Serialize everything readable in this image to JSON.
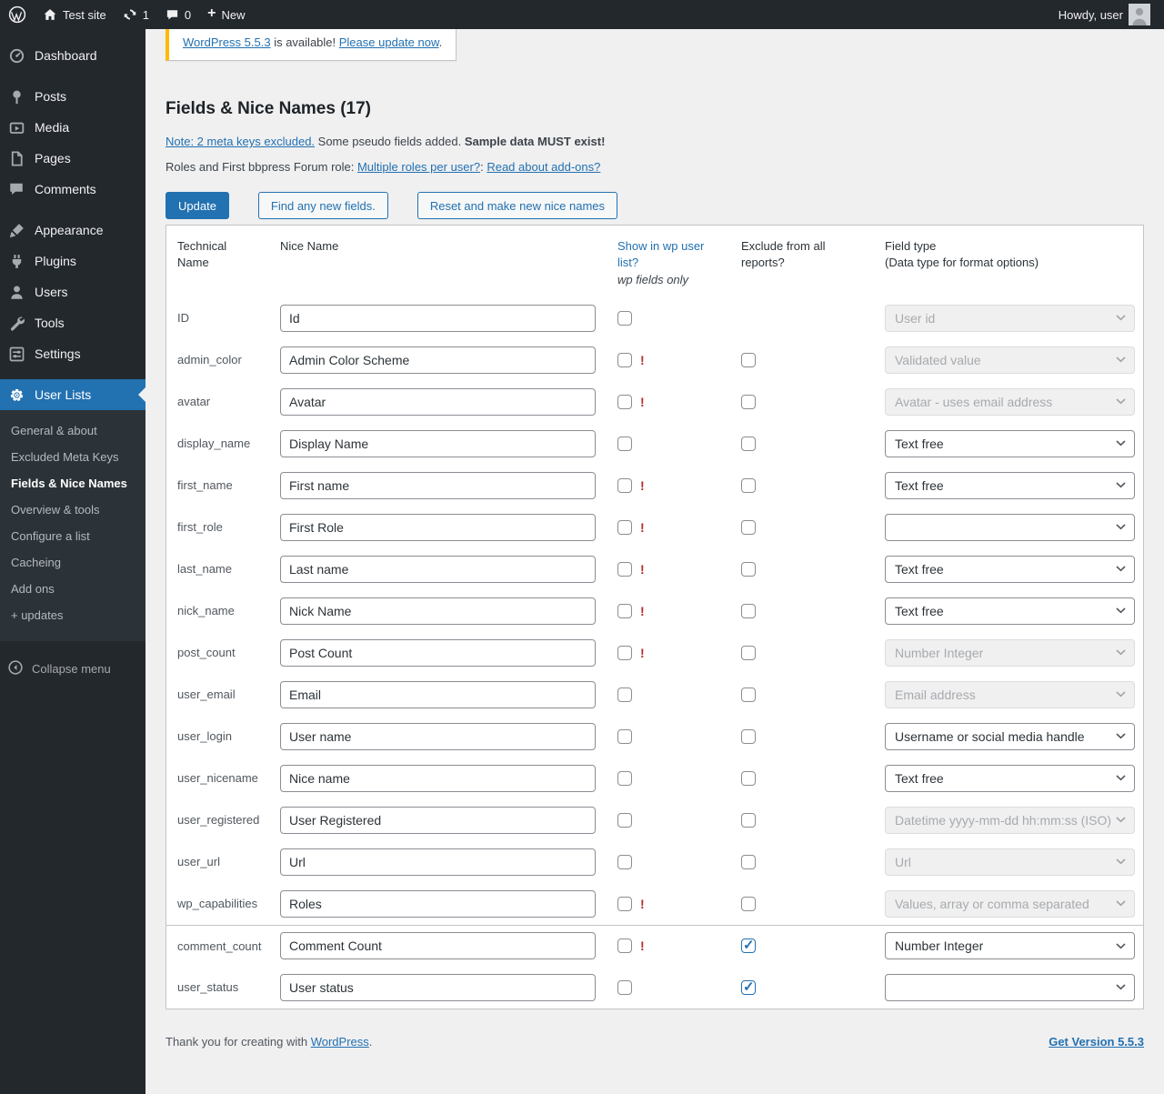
{
  "colors": {
    "accent": "#2271b1",
    "warning": "#b32d2e",
    "notice_accent": "#ffb900",
    "bar": "#23282d",
    "pagebg": "#f0f0f1"
  },
  "admin_bar": {
    "site_name": "Test site",
    "update_count": "1",
    "comment_count": "0",
    "new_label": "New",
    "howdy": "Howdy, user"
  },
  "sidebar": {
    "items": [
      {
        "label": "Dashboard",
        "icon": "dashboard-icon"
      },
      {
        "label": "Posts",
        "icon": "pin-icon"
      },
      {
        "label": "Media",
        "icon": "media-icon"
      },
      {
        "label": "Pages",
        "icon": "pages-icon"
      },
      {
        "label": "Comments",
        "icon": "comment-bubble-icon"
      },
      {
        "label": "Appearance",
        "icon": "brush-icon"
      },
      {
        "label": "Plugins",
        "icon": "plug-icon"
      },
      {
        "label": "Users",
        "icon": "person-icon"
      },
      {
        "label": "Tools",
        "icon": "wrench-icon"
      },
      {
        "label": "Settings",
        "icon": "settings-icon"
      },
      {
        "label": "User Lists",
        "icon": "gear-icon"
      }
    ],
    "submenu": [
      {
        "label": "General & about",
        "current": false
      },
      {
        "label": "Excluded Meta Keys",
        "current": false
      },
      {
        "label": "Fields & Nice Names",
        "current": true
      },
      {
        "label": "Overview & tools",
        "current": false
      },
      {
        "label": "Configure a list",
        "current": false
      },
      {
        "label": "Cacheing",
        "current": false
      },
      {
        "label": "Add ons",
        "current": false
      },
      {
        "label": "+ updates",
        "current": false
      }
    ],
    "collapse_label": "Collapse menu"
  },
  "notice": {
    "link": "WordPress 5.5.3",
    "middle": " is available! ",
    "action": "Please update now",
    "period": "."
  },
  "page": {
    "title": "Fields & Nice Names (17)",
    "note_link": "Note: 2 meta keys excluded.",
    "note_text": " Some pseudo fields added. ",
    "note_bold": "Sample data MUST exist!",
    "roles_text": "Roles and First bbpress Forum role: ",
    "roles_link1": "Multiple roles per user?",
    "roles_sep": ": ",
    "roles_link2": "Read about add-ons?"
  },
  "toolbar": {
    "update": "Update",
    "find": "Find any new fields.",
    "reset": "Reset and make new nice names"
  },
  "table": {
    "warning_mark": "!",
    "headers": {
      "technical": "Technical Name",
      "nice": "Nice Name",
      "show_link": "Show in wp user list?",
      "show_note": "wp fields only",
      "exclude": "Exclude from all reports?",
      "field_type": "Field type",
      "field_type_note": "(Data type for format options)"
    },
    "rows": [
      {
        "tech": "ID",
        "nice": "Id",
        "bang": false,
        "has_exclude": false,
        "exclude_checked": false,
        "type": "User id",
        "type_disabled": true,
        "group_start": false
      },
      {
        "tech": "admin_color",
        "nice": "Admin Color Scheme",
        "bang": true,
        "has_exclude": true,
        "exclude_checked": false,
        "type": "Validated value",
        "type_disabled": true,
        "group_start": false
      },
      {
        "tech": "avatar",
        "nice": "Avatar",
        "bang": true,
        "has_exclude": true,
        "exclude_checked": false,
        "type": "Avatar - uses email address",
        "type_disabled": true,
        "group_start": false
      },
      {
        "tech": "display_name",
        "nice": "Display Name",
        "bang": false,
        "has_exclude": true,
        "exclude_checked": false,
        "type": "Text free",
        "type_disabled": false,
        "group_start": false
      },
      {
        "tech": "first_name",
        "nice": "First name",
        "bang": true,
        "has_exclude": true,
        "exclude_checked": false,
        "type": "Text free",
        "type_disabled": false,
        "group_start": false
      },
      {
        "tech": "first_role",
        "nice": "First Role",
        "bang": true,
        "has_exclude": true,
        "exclude_checked": false,
        "type": "",
        "type_disabled": false,
        "group_start": false
      },
      {
        "tech": "last_name",
        "nice": "Last name",
        "bang": true,
        "has_exclude": true,
        "exclude_checked": false,
        "type": "Text free",
        "type_disabled": false,
        "group_start": false
      },
      {
        "tech": "nick_name",
        "nice": "Nick Name",
        "bang": true,
        "has_exclude": true,
        "exclude_checked": false,
        "type": "Text free",
        "type_disabled": false,
        "group_start": false
      },
      {
        "tech": "post_count",
        "nice": "Post Count",
        "bang": true,
        "has_exclude": true,
        "exclude_checked": false,
        "type": "Number Integer",
        "type_disabled": true,
        "group_start": false
      },
      {
        "tech": "user_email",
        "nice": "Email",
        "bang": false,
        "has_exclude": true,
        "exclude_checked": false,
        "type": "Email address",
        "type_disabled": true,
        "group_start": false
      },
      {
        "tech": "user_login",
        "nice": "User name",
        "bang": false,
        "has_exclude": true,
        "exclude_checked": false,
        "type": "Username or social media handle",
        "type_disabled": false,
        "group_start": false
      },
      {
        "tech": "user_nicename",
        "nice": "Nice name",
        "bang": false,
        "has_exclude": true,
        "exclude_checked": false,
        "type": "Text free",
        "type_disabled": false,
        "group_start": false
      },
      {
        "tech": "user_registered",
        "nice": "User Registered",
        "bang": false,
        "has_exclude": true,
        "exclude_checked": false,
        "type": "Datetime yyyy-mm-dd hh:mm:ss (ISO)",
        "type_disabled": true,
        "group_start": false
      },
      {
        "tech": "user_url",
        "nice": "Url",
        "bang": false,
        "has_exclude": true,
        "exclude_checked": false,
        "type": "Url",
        "type_disabled": true,
        "group_start": false
      },
      {
        "tech": "wp_capabilities",
        "nice": "Roles",
        "bang": true,
        "has_exclude": true,
        "exclude_checked": false,
        "type": "Values, array or comma separated",
        "type_disabled": true,
        "group_start": false
      },
      {
        "tech": "comment_count",
        "nice": "Comment Count",
        "bang": true,
        "has_exclude": true,
        "exclude_checked": true,
        "type": "Number Integer",
        "type_disabled": false,
        "group_start": true
      },
      {
        "tech": "user_status",
        "nice": "User status",
        "bang": false,
        "has_exclude": true,
        "exclude_checked": true,
        "type": "",
        "type_disabled": false,
        "group_start": false
      }
    ]
  },
  "footer": {
    "thanks_text": "Thank you for creating with ",
    "thanks_link": "WordPress",
    "thanks_period": ".",
    "version_link": "Get Version 5.5.3"
  }
}
